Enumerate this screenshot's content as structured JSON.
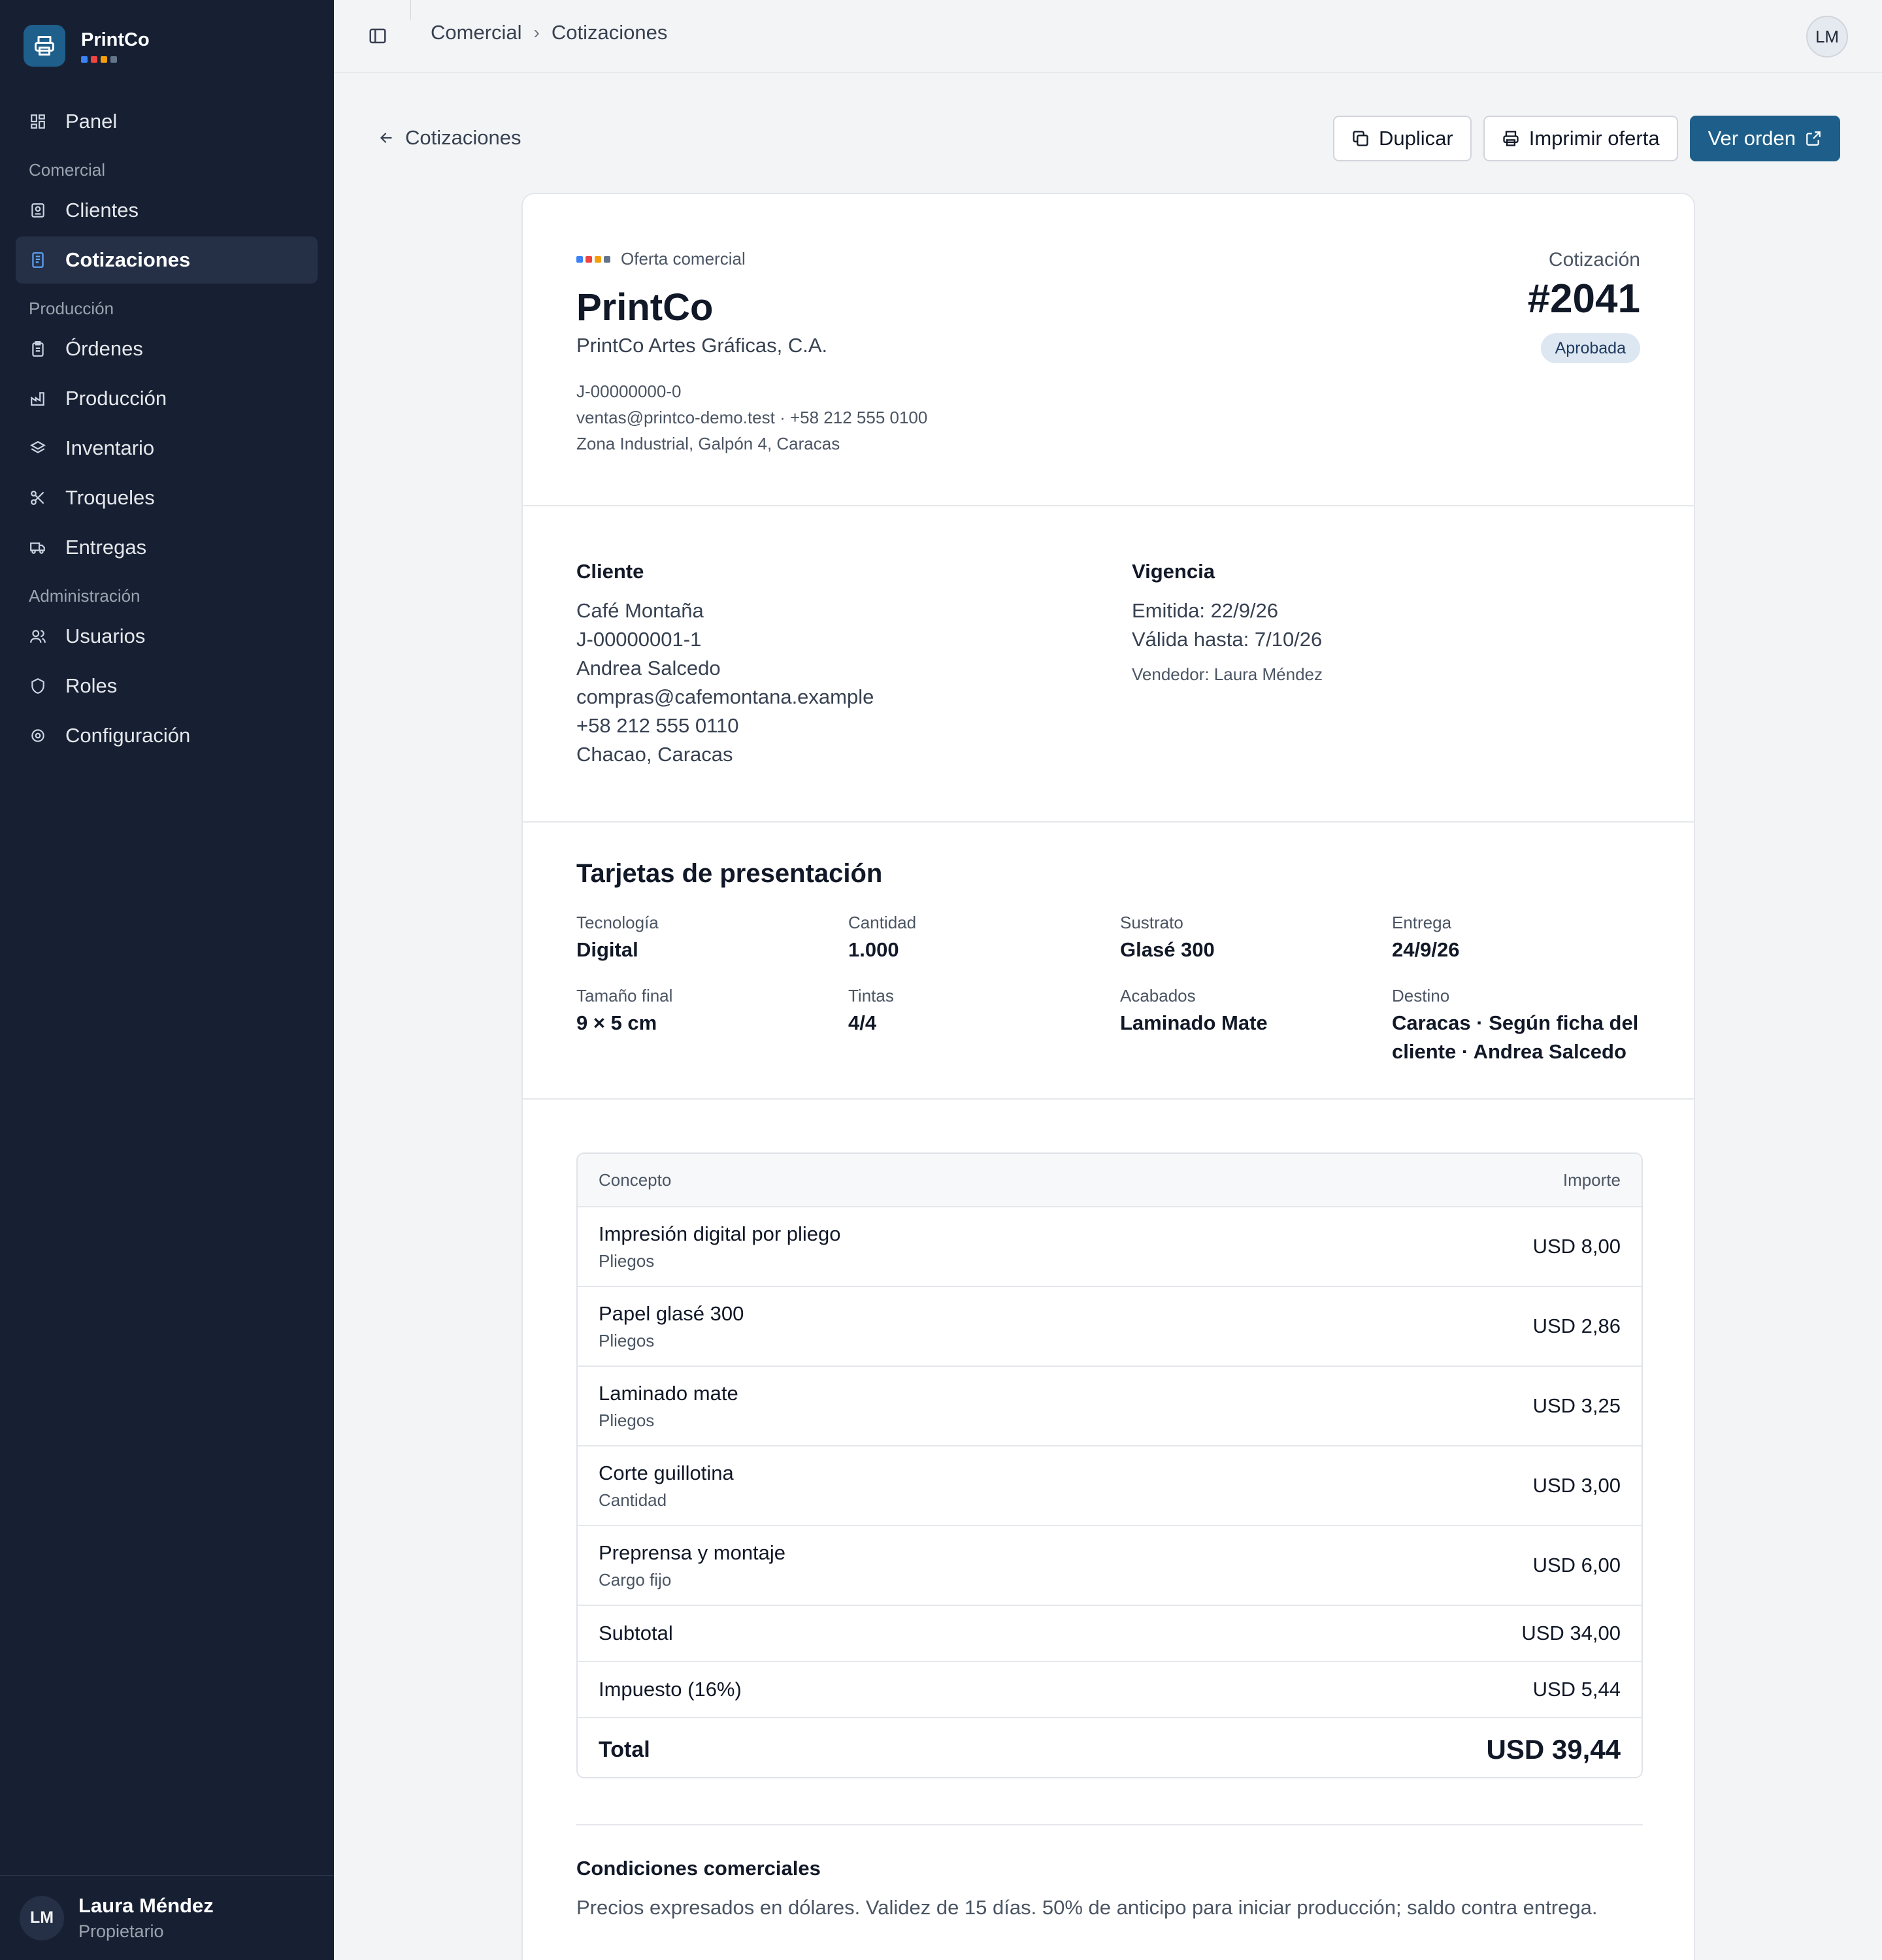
{
  "brand": {
    "name": "PrintCo",
    "dot_colors": [
      "#3b82f6",
      "#ef4444",
      "#f59e0b",
      "#64748b"
    ]
  },
  "sidebar": {
    "panel": "Panel",
    "section_comercial": "Comercial",
    "clientes": "Clientes",
    "cotizaciones": "Cotizaciones",
    "section_produccion": "Producción",
    "ordenes": "Órdenes",
    "produccion": "Producción",
    "inventario": "Inventario",
    "troqueles": "Troqueles",
    "entregas": "Entregas",
    "section_admin": "Administración",
    "usuarios": "Usuarios",
    "roles": "Roles",
    "configuracion": "Configuración"
  },
  "user": {
    "initials": "LM",
    "name": "Laura Méndez",
    "role": "Propietario"
  },
  "topbar": {
    "crumb1": "Comercial",
    "crumb2": "Cotizaciones",
    "avatar": "LM"
  },
  "toolbar": {
    "back": "Cotizaciones",
    "duplicar": "Duplicar",
    "imprimir": "Imprimir oferta",
    "ver_orden": "Ver orden"
  },
  "quote": {
    "eyebrow": "Oferta comercial",
    "company": "PrintCo",
    "legal_name": "PrintCo Artes Gráficas, C.A.",
    "rif": "J-00000000-0",
    "contact": "ventas@printco-demo.test · +58 212 555 0100",
    "address": "Zona Industrial, Galpón 4, Caracas",
    "label": "Cotización",
    "number": "#2041",
    "status": "Aprobada",
    "accent": "#1d5f8a"
  },
  "client": {
    "heading": "Cliente",
    "name": "Café Montaña",
    "rif": "J-00000001-1",
    "contact": "Andrea Salcedo",
    "email": "compras@cafemontana.example",
    "phone": "+58 212 555 0110",
    "city": "Chacao, Caracas"
  },
  "validity": {
    "heading": "Vigencia",
    "issued": "Emitida: 22/9/26",
    "valid_until": "Válida hasta: 7/10/26",
    "seller": "Vendedor: Laura Méndez"
  },
  "job": {
    "title": "Tarjetas de presentación",
    "specs": [
      {
        "k": "Tecnología",
        "v": "Digital"
      },
      {
        "k": "Cantidad",
        "v": "1.000"
      },
      {
        "k": "Sustrato",
        "v": "Glasé 300"
      },
      {
        "k": "Entrega",
        "v": "24/9/26"
      },
      {
        "k": "Tamaño final",
        "v": "9 × 5 cm"
      },
      {
        "k": "Tintas",
        "v": "4/4"
      },
      {
        "k": "Acabados",
        "v": "Laminado Mate"
      },
      {
        "k": "Destino",
        "v": "Caracas · Según ficha del cliente · Andrea Salcedo"
      }
    ]
  },
  "table": {
    "col_concept": "Concepto",
    "col_amount": "Importe",
    "rows": [
      {
        "name": "Impresión digital por pliego",
        "unit": "Pliegos",
        "amount": "USD 8,00"
      },
      {
        "name": "Papel glasé 300",
        "unit": "Pliegos",
        "amount": "USD 2,86"
      },
      {
        "name": "Laminado mate",
        "unit": "Pliegos",
        "amount": "USD 3,25"
      },
      {
        "name": "Corte guillotina",
        "unit": "Cantidad",
        "amount": "USD 3,00"
      },
      {
        "name": "Preprensa y montaje",
        "unit": "Cargo fijo",
        "amount": "USD 6,00"
      }
    ],
    "subtotal_label": "Subtotal",
    "subtotal": "USD 34,00",
    "tax_label": "Impuesto (16%)",
    "tax": "USD 5,44",
    "total_label": "Total",
    "total": "USD 39,44"
  },
  "conditions": {
    "title": "Condiciones comerciales",
    "text": "Precios expresados en dólares. Validez de 15 días. 50% de anticipo para iniciar producción; saldo contra entrega."
  }
}
